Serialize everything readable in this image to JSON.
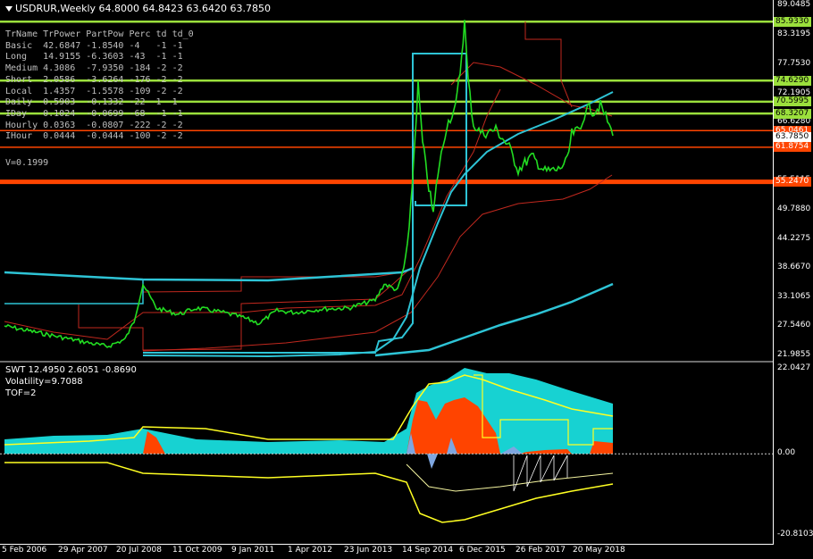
{
  "chart_title": "USDRUR,Weekly  64.8000 64.8423 63.6420 63.7850",
  "trpower_table": {
    "headers": [
      "TrName",
      "TrPower",
      "PartPow",
      "Perc",
      "td",
      "td_0"
    ],
    "rows": [
      [
        "Basic",
        "42.6847",
        "-1.8540",
        "-4",
        "-1",
        "-1"
      ],
      [
        "Long",
        "14.9155",
        "-6.3603",
        "-43",
        "-1",
        "-1"
      ],
      [
        "Medium",
        "4.3086",
        "-7.9350",
        "-184",
        "-2",
        "-2"
      ],
      [
        "Short",
        "2.0586",
        "-3.6264",
        "-176",
        "-2",
        "-2"
      ],
      [
        "Local",
        "1.4357",
        "-1.5578",
        "-109",
        "-2",
        "-2"
      ],
      [
        "Daily",
        "0.5903",
        "-0.1332",
        "-22",
        "1",
        "1"
      ],
      [
        "IDay",
        "0.1024",
        "-0.0699",
        "-68",
        "-1",
        "-1"
      ],
      [
        "Hourly",
        "0.0363",
        "-0.0807",
        "-222",
        "-2",
        "-2"
      ],
      [
        "IHour",
        "0.0444",
        "-0.0444",
        "-100",
        "-2",
        "-2"
      ]
    ],
    "v_line": "V=0.1999"
  },
  "indicator_panel": {
    "line1": "SWT 12.4950 2.6051 -0.8690",
    "line2": "Volatility=9.7088",
    "line3": "TOF=2"
  },
  "price_axis": {
    "labels": [
      "89.0485",
      "83.3195",
      "77.7530",
      "72.1905",
      "66.6280",
      "61.0775",
      "55.5115",
      "49.7880",
      "44.2275",
      "38.6670",
      "33.1065",
      "27.5460",
      "21.9855"
    ],
    "values": [
      89.0485,
      83.3195,
      77.753,
      72.1905,
      66.628,
      61.0775,
      55.5115,
      49.788,
      44.2275,
      38.667,
      33.1065,
      27.546,
      21.9855
    ]
  },
  "price_tags": [
    {
      "text": "85.9330",
      "value": 85.933,
      "bg": "#9be03c",
      "fg": "#000000"
    },
    {
      "text": "74.6290",
      "value": 74.629,
      "bg": "#9be03c",
      "fg": "#000000"
    },
    {
      "text": "70.5995",
      "value": 70.5995,
      "bg": "#9be03c",
      "fg": "#000000"
    },
    {
      "text": "68.3207",
      "value": 68.3207,
      "bg": "#9be03c",
      "fg": "#000000"
    },
    {
      "text": "65.0461",
      "value": 65.0461,
      "bg": "#ff4500",
      "fg": "#ffffff"
    },
    {
      "text": "63.7850",
      "value": 63.785,
      "bg": "#ffffff",
      "fg": "#000000"
    },
    {
      "text": "61.8754",
      "value": 61.8754,
      "bg": "#ff4500",
      "fg": "#ffffff"
    },
    {
      "text": "55.2470",
      "value": 55.247,
      "bg": "#ff4500",
      "fg": "#ffffff"
    }
  ],
  "indicator_axis": {
    "labels": [
      "22.0427",
      "0.00",
      "-20.8103"
    ],
    "values": [
      22.0427,
      0.0,
      -20.8103
    ]
  },
  "date_axis": [
    "5 Feb 2006",
    "29 Apr 2007",
    "20 Jul 2008",
    "11 Oct 2009",
    "9 Jan 2011",
    "1 Apr 2012",
    "23 Jun 2013",
    "14 Sep 2014",
    "6 Dec 2015",
    "26 Feb 2017",
    "20 May 2018"
  ],
  "colors": {
    "background": "#000000",
    "price_line": "#22dd22",
    "green_level": "#9be03c",
    "red_level": "#ff4500",
    "cyan": "#2ec4d6",
    "thin_red": "#c0281e",
    "yellow": "#ffff22",
    "fill_cyan": "#17d2d2",
    "fill_orange": "#ff4400",
    "fill_blue": "#7ea6e0"
  },
  "chart_data": {
    "type": "line",
    "title": "USDRUR,Weekly",
    "x": [
      "5 Feb 2006",
      "29 Apr 2007",
      "20 Jul 2008",
      "11 Oct 2009",
      "9 Jan 2011",
      "1 Apr 2012",
      "23 Jun 2013",
      "14 Sep 2014",
      "6 Dec 2015",
      "26 Feb 2017",
      "20 May 2018"
    ],
    "series": [
      {
        "name": "USDRUR",
        "values": [
          27.0,
          24.5,
          24.0,
          29.5,
          30.5,
          31.0,
          32.0,
          50.0,
          70.0,
          57.0,
          63.8
        ]
      }
    ],
    "ylim": [
      21.9855,
      89.0485
    ],
    "grid": false
  }
}
